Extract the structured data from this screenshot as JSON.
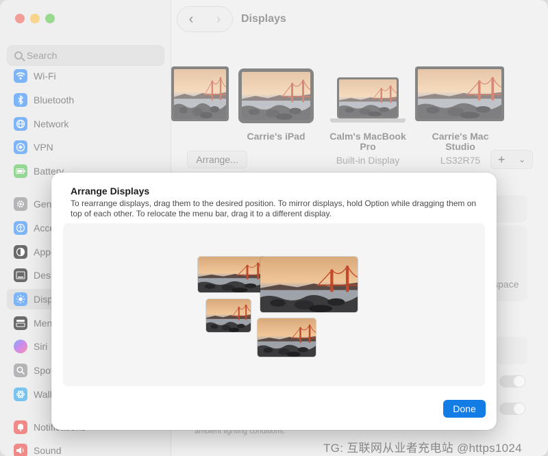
{
  "window": {
    "title": "Displays"
  },
  "colors": {
    "accent": "#147ce5",
    "close": "#ec6a5e",
    "minimize": "#f4bf4f",
    "maximize": "#61c554"
  },
  "sidebar": {
    "search_placeholder": "Search",
    "items": [
      {
        "label": "Wi-Fi",
        "icon": "wifi-icon",
        "color": "#3a8ef6"
      },
      {
        "label": "Bluetooth",
        "icon": "bluetooth-icon",
        "color": "#3a8ef6"
      },
      {
        "label": "Network",
        "icon": "globe-icon",
        "color": "#3a8ef6"
      },
      {
        "label": "VPN",
        "icon": "vpn-icon",
        "color": "#3a8ef6"
      },
      {
        "label": "Battery",
        "icon": "battery-icon",
        "color": "#5bc35b"
      },
      {
        "label": "General",
        "icon": "gear-icon",
        "color": "#8e8e93"
      },
      {
        "label": "Accessibility",
        "icon": "accessibility-icon",
        "color": "#3a8ef6"
      },
      {
        "label": "Appearance",
        "icon": "appearance-icon",
        "color": "#1d1d1f"
      },
      {
        "label": "Desktop & Dock",
        "icon": "dock-icon",
        "color": "#1d1d1f"
      },
      {
        "label": "Displays",
        "icon": "sun-icon",
        "color": "#3a8ef6"
      },
      {
        "label": "Menu Bar",
        "icon": "menubar-icon",
        "color": "#1d1d1f"
      },
      {
        "label": "Siri",
        "icon": "siri-icon",
        "color": "#b54ce0"
      },
      {
        "label": "Spotlight",
        "icon": "spotlight-icon",
        "color": "#8e8e93"
      },
      {
        "label": "Wallpaper",
        "icon": "wallpaper-icon",
        "color": "#33a4e6"
      },
      {
        "label": "Notifications",
        "icon": "bell-icon",
        "color": "#ec4b4b"
      },
      {
        "label": "Sound",
        "icon": "speaker-icon",
        "color": "#ec4b4b"
      }
    ]
  },
  "displays": [
    {
      "name": "Carrie's iPad",
      "sub": ""
    },
    {
      "name": "Calm's MacBook Pro",
      "sub": "Built-in Display"
    },
    {
      "name": "Carrie's Mac Studio",
      "sub": "LS32R75"
    }
  ],
  "main": {
    "arrange_label": "Arrange...",
    "add_label": "+",
    "space_label": "space",
    "footnote": "ambient lighting conditions."
  },
  "modal": {
    "title": "Arrange Displays",
    "description": "To rearrange displays, drag them to the desired position. To mirror displays, hold Option while dragging them on top of each other. To relocate the menu bar, drag it to a different display.",
    "done_label": "Done"
  },
  "watermark": "TG: 互联网从业者充电站 @https1024"
}
